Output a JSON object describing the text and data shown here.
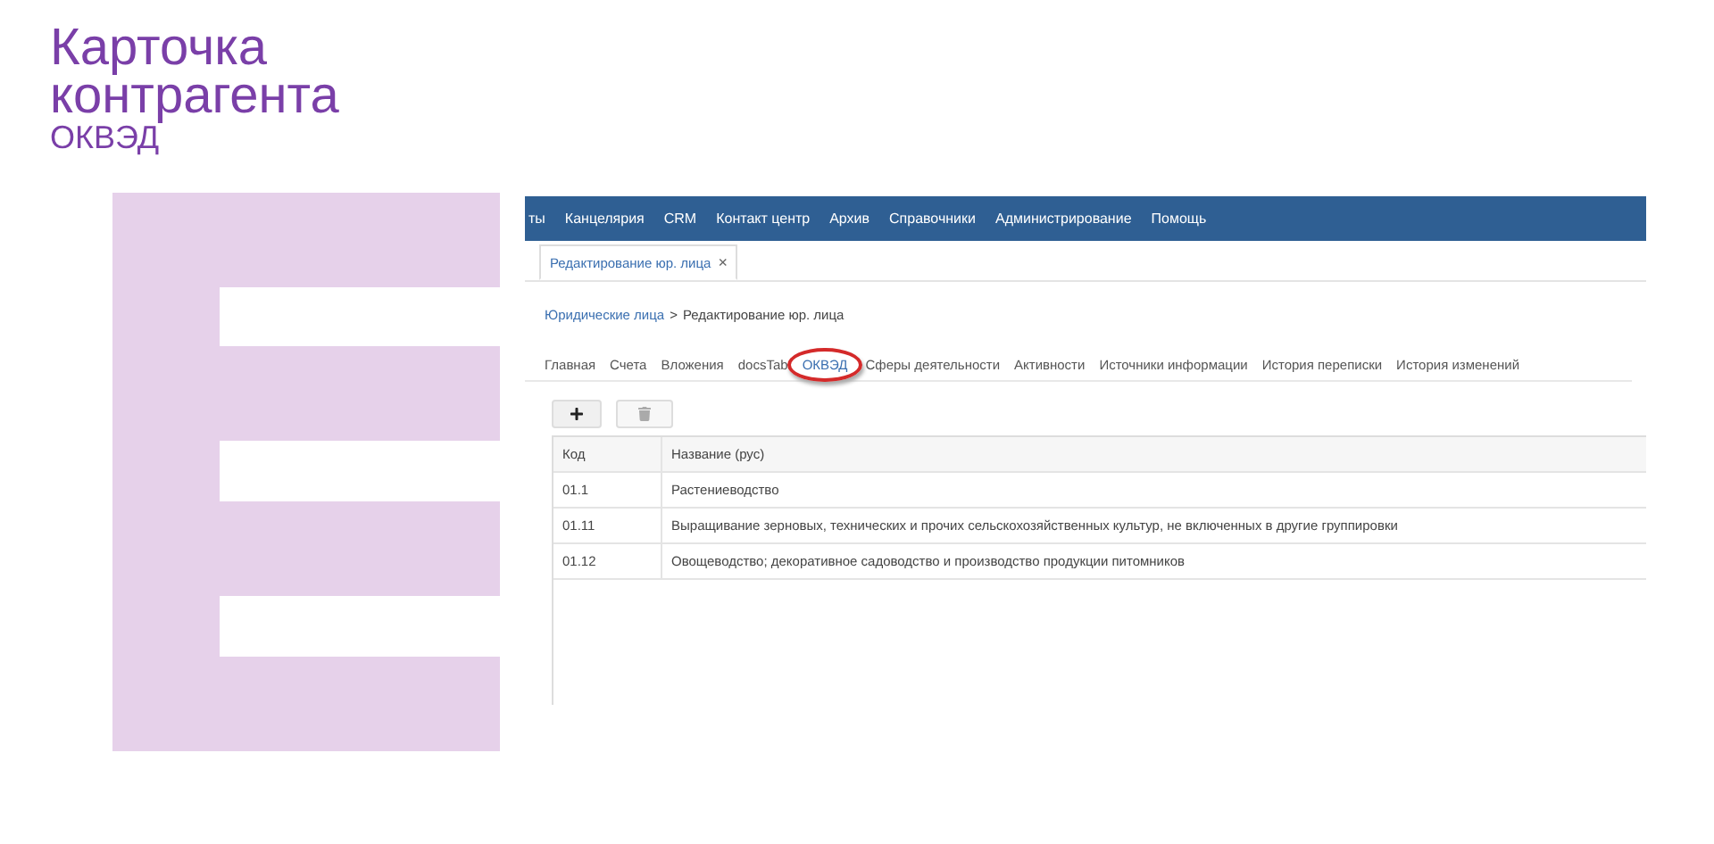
{
  "slide": {
    "title": "Карточка контрагента",
    "subtitle": "ОКВЭД"
  },
  "app": {
    "menu": [
      "ты",
      "Канцелярия",
      "CRM",
      "Контакт центр",
      "Архив",
      "Справочники",
      "Администрирование",
      "Помощь"
    ],
    "doc_tabs": [
      {
        "label": "Редактирование юр. лица",
        "close": "×",
        "selected": true
      }
    ],
    "breadcrumb": {
      "link": "Юридические лица",
      "separator": ">",
      "current": "Редактирование юр. лица"
    },
    "tabs": [
      {
        "label": "Главная",
        "selected": false
      },
      {
        "label": "Счета",
        "selected": false
      },
      {
        "label": "Вложения",
        "selected": false
      },
      {
        "label": "docsTab",
        "selected": false
      },
      {
        "label": "ОКВЭД",
        "selected": true
      },
      {
        "label": "Сферы деятельности",
        "selected": false
      },
      {
        "label": "Активности",
        "selected": false
      },
      {
        "label": "Источники информации",
        "selected": false
      },
      {
        "label": "История переписки",
        "selected": false
      },
      {
        "label": "История изменений",
        "selected": false
      }
    ],
    "toolbar": [
      {
        "kind": "add",
        "disabled": false
      },
      {
        "kind": "delete",
        "disabled": true
      }
    ],
    "table": {
      "columns": [
        "Код",
        "Название (рус)"
      ],
      "rows": [
        [
          "01.1",
          "Растениеводство"
        ],
        [
          "01.11",
          "Выращивание зерновых, технических и прочих сельскохозяйственных культур, не включенных в другие группировки"
        ],
        [
          "01.12",
          "Овощеводство; декоративное садоводство и производство продукции питомников"
        ]
      ]
    }
  }
}
